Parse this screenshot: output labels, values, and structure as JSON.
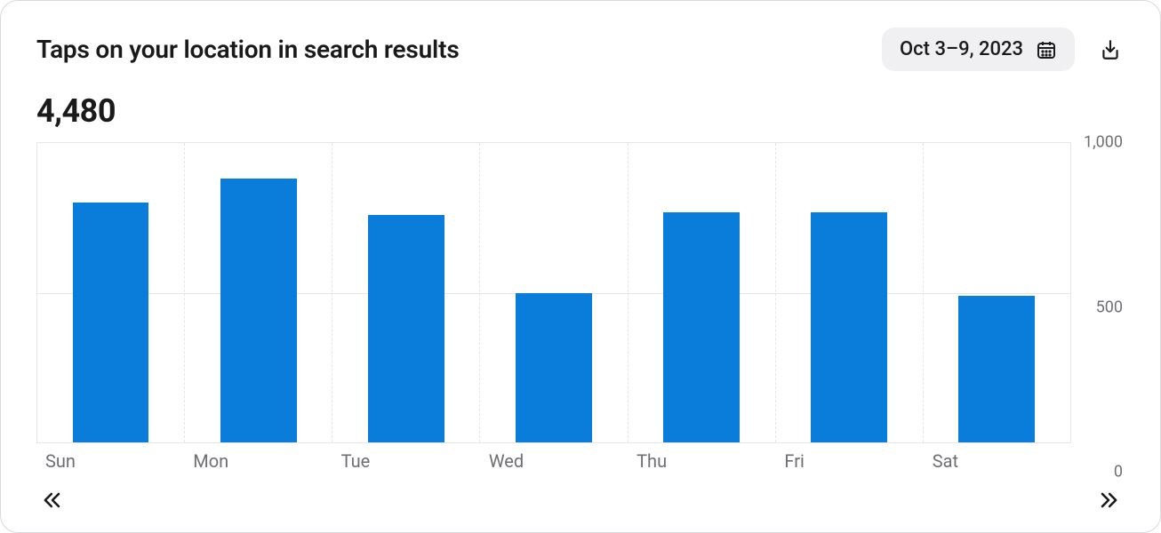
{
  "header": {
    "title": "Taps on your location in search results",
    "date_range": "Oct 3–9, 2023"
  },
  "total": "4,480",
  "chart_data": {
    "type": "bar",
    "title": "Taps on your location in search results",
    "xlabel": "",
    "ylabel": "",
    "ylim": [
      0,
      1000
    ],
    "yticks": [
      0,
      500,
      1000
    ],
    "categories": [
      "Sun",
      "Mon",
      "Tue",
      "Wed",
      "Thu",
      "Fri",
      "Sat"
    ],
    "values": [
      800,
      880,
      760,
      500,
      770,
      770,
      490
    ],
    "bar_color": "#0a7cda"
  },
  "yticks_labels": [
    "1,000",
    "500",
    "0"
  ]
}
